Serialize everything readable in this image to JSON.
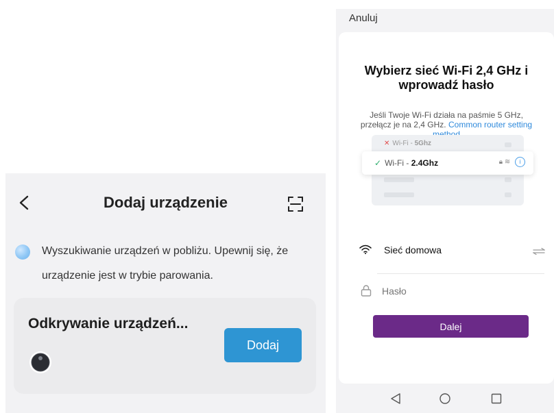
{
  "left": {
    "title": "Dodaj urządzenie",
    "status_text": "Wyszukiwanie urządzeń w pobliżu. Upewnij się, że urządzenie jest w trybie parowania.",
    "card": {
      "heading": "Odkrywanie urządzeń...",
      "add_label": "Dodaj",
      "device_icon": "robot-vacuum-icon"
    },
    "icons": [
      "back-arrow-icon",
      "scan-icon",
      "search-indicator-icon"
    ]
  },
  "right": {
    "cancel_label": "Anuluj",
    "headline": "Wybierz sieć Wi-Fi 2,4 GHz i wprowadź hasło",
    "hint_text": "Jeśli Twoje Wi-Fi działa na paśmie 5 GHz, przełącz je na 2,4 GHz.",
    "hint_link": "Common router setting method",
    "illustration": {
      "wifi5_prefix": "Wi-Fi - ",
      "wifi5_band": "5Ghz",
      "wifi24_prefix": "Wi-Fi - ",
      "wifi24_band": "2.4Ghz"
    },
    "network_name": "Sieć domowa",
    "password_placeholder": "Hasło",
    "next_label": "Dalej",
    "nav_icons": [
      "back-triangle-icon",
      "home-circle-icon",
      "recents-square-icon"
    ]
  },
  "colors": {
    "primary_blue": "#2e95d3",
    "link_blue": "#2e89db",
    "next_purple": "#6b2a88",
    "check_green": "#2fae6e",
    "cross_red": "#e24b4b"
  }
}
